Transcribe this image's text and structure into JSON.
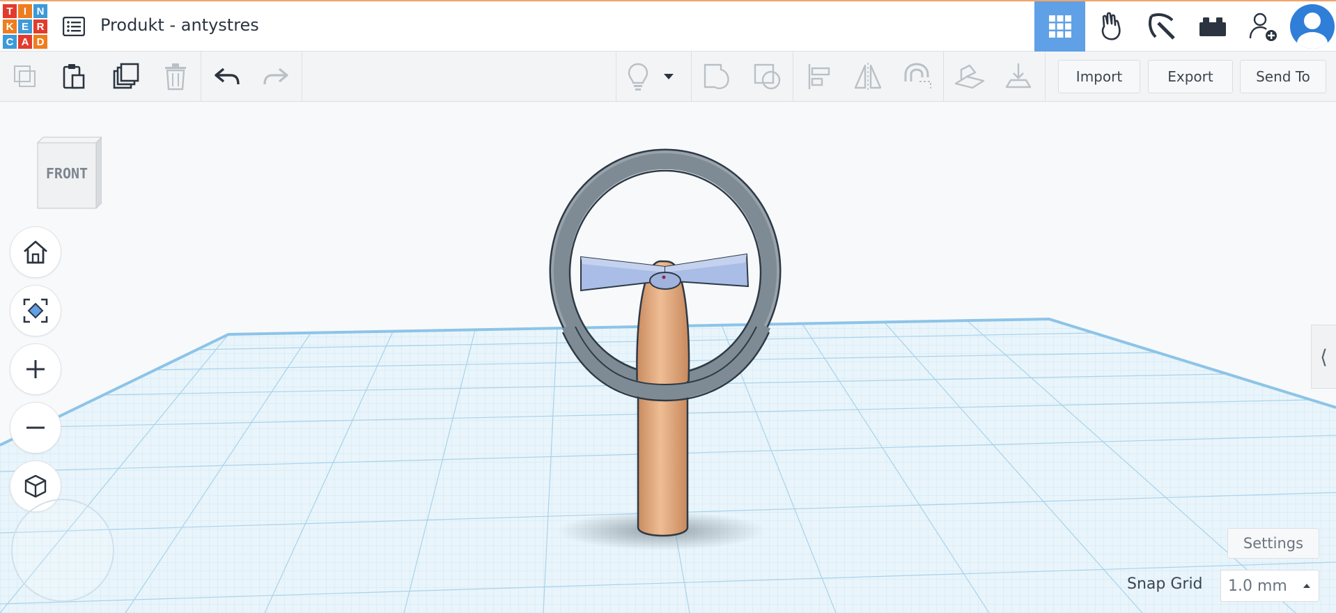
{
  "app": {
    "document_title": "Produkt - antystres",
    "logo_letters": [
      "T",
      "I",
      "N",
      "K",
      "E",
      "R",
      "C",
      "A",
      "D"
    ],
    "logo_colors": [
      "#e23b2e",
      "#ef7d1f",
      "#3d9ad9",
      "#ef7d1f",
      "#3d9ad9",
      "#e23b2e",
      "#3d9ad9",
      "#e23b2e",
      "#ef7d1f"
    ]
  },
  "top_nav": {
    "items": [
      {
        "name": "3d-design-grid-icon",
        "active": true
      },
      {
        "name": "circuits-hand-icon",
        "active": false
      },
      {
        "name": "codeblocks-pickaxe-icon",
        "active": false
      },
      {
        "name": "bricks-icon",
        "active": false
      },
      {
        "name": "add-user-icon",
        "active": false
      }
    ]
  },
  "toolbar": {
    "import_label": "Import",
    "export_label": "Export",
    "send_to_label": "Send To"
  },
  "viewport": {
    "viewcube_label": "FRONT",
    "settings_label": "Settings",
    "snap_grid_label": "Snap Grid",
    "snap_grid_value": "1.0 mm"
  },
  "colors": {
    "accent": "#5fa0e6",
    "handle": "#e2a77d",
    "ring": "#7f8b94",
    "blades": "#a9bde6",
    "grid_edge": "#8cc4e8"
  }
}
